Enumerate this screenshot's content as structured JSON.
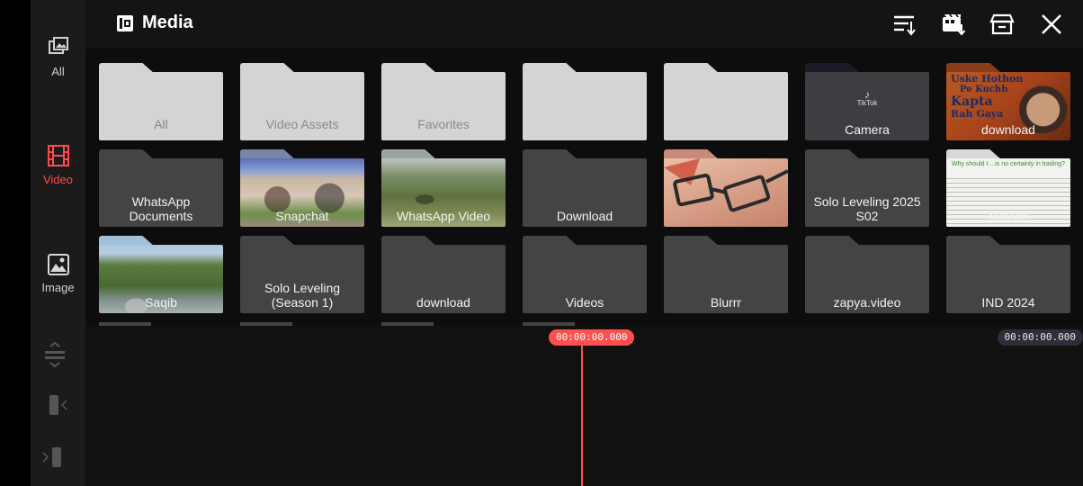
{
  "header": {
    "title": "Media"
  },
  "sidebar": {
    "items": [
      {
        "label": "All",
        "icon": "gallery-icon",
        "active": false
      },
      {
        "label": "Video",
        "icon": "film-icon",
        "active": true
      },
      {
        "label": "Image",
        "icon": "image-icon",
        "active": false
      }
    ]
  },
  "folders": [
    {
      "label": "All"
    },
    {
      "label": "Video Assets"
    },
    {
      "label": "Favorites"
    },
    {
      "label": ""
    },
    {
      "label": ""
    },
    {
      "label": "Camera"
    },
    {
      "label": "download"
    },
    {
      "label": "WhatsApp Documents"
    },
    {
      "label": "Snapchat"
    },
    {
      "label": "WhatsApp Video"
    },
    {
      "label": "Download"
    },
    {
      "label": ""
    },
    {
      "label": "Solo Leveling 2025 S02"
    },
    {
      "label": "Movies"
    },
    {
      "label": "Saqib"
    },
    {
      "label": "Solo Leveling (Season 1)"
    },
    {
      "label": "download"
    },
    {
      "label": "Videos"
    },
    {
      "label": "Blurrr"
    },
    {
      "label": "zapya.video"
    },
    {
      "label": "IND 2024"
    }
  ],
  "thumbs": {
    "tiktok": "TikTok",
    "poster": [
      "Uske Hothon",
      "Pe Kuchh",
      "Kapta",
      "Rah Gaya"
    ],
    "movies_heading": "Why should I ...is no certainty in trading?"
  },
  "timeline": {
    "current_time": "00:00:00.000",
    "total_time": "00:00:00.000"
  },
  "colors": {
    "accent": "#ff4a4a",
    "light_folder": "#d4d4d4",
    "dark_folder": "#444444"
  }
}
